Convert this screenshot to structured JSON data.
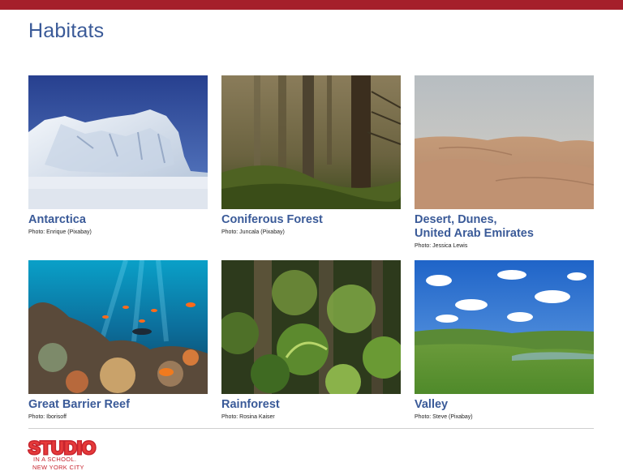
{
  "page": {
    "title": "Habitats"
  },
  "habitats": [
    {
      "title": "Antarctica",
      "credit": "Photo: Enrique (Pixabay)"
    },
    {
      "title": "Coniferous Forest",
      "credit": "Photo: Juncala (Pixabay)"
    },
    {
      "title": "Desert, Dunes,\nUnited Arab Emirates",
      "credit": "Photo: Jessica Lewis"
    },
    {
      "title": "Great Barrier Reef",
      "credit": "Photo: Iborisoff"
    },
    {
      "title": "Rainforest",
      "credit": "Photo: Rosina Kaiser"
    },
    {
      "title": "Valley",
      "credit": "Photo: Steve (Pixabay)"
    }
  ],
  "logo": {
    "wordmark": "STUDIO",
    "line1": "IN A SCHOOL.",
    "line2": "NEW YORK CITY"
  },
  "colors": {
    "accent_bar": "#a51f2b",
    "title_blue": "#3a5a98",
    "logo_red": "#c7242e"
  }
}
